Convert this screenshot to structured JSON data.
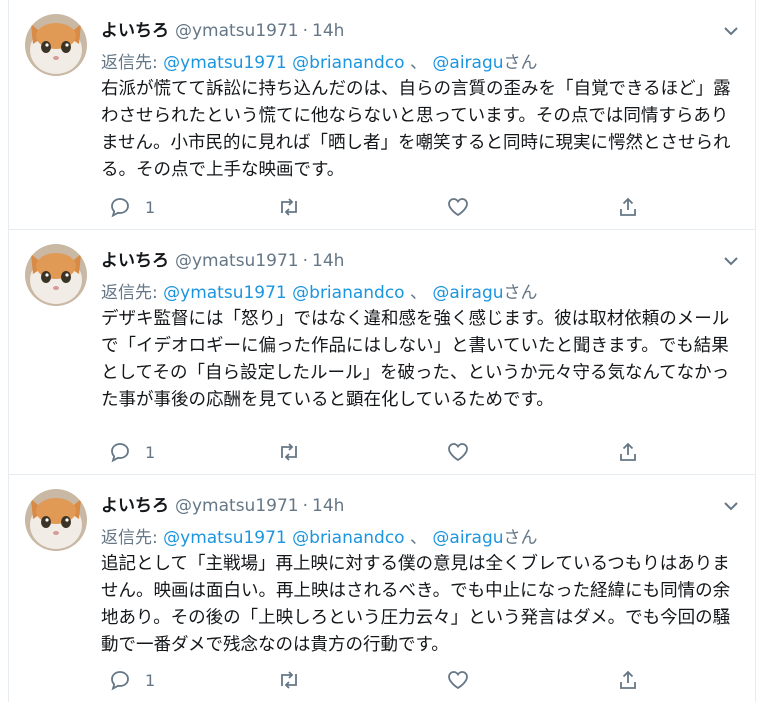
{
  "tweets": [
    {
      "name": "よいちろ",
      "handle": "@ymatsu1971",
      "dot": "·",
      "time": "14h",
      "reply_prefix": "返信先:",
      "reply_to_1": "@ymatsu1971",
      "reply_to_2": "@brianandco",
      "reply_sep": "、",
      "reply_to_3": "@airagu",
      "reply_suffix": "さん",
      "text": "右派が慌てて訴訟に持ち込んだのは、自らの言質の歪みを「自覚できるほど」露わさせられたという慌てに他ならないと思っています。その点では同情すらありません。小市民的に見れば「晒し者」を嘲笑すると同時に現実に愕然とさせられる。その点で上手な映画です。",
      "reply_count": "1"
    },
    {
      "name": "よいちろ",
      "handle": "@ymatsu1971",
      "dot": "·",
      "time": "14h",
      "reply_prefix": "返信先:",
      "reply_to_1": "@ymatsu1971",
      "reply_to_2": "@brianandco",
      "reply_sep": "、",
      "reply_to_3": "@airagu",
      "reply_suffix": "さん",
      "text": "デザキ監督には「怒り」ではなく違和感を強く感じます。彼は取材依頼のメールで「イデオロギーに偏った作品にはしない」と書いていたと聞きます。でも結果としてその「自ら設定したルール」を破った、というか元々守る気なんてなかった事が事後の応酬を見ていると顕在化しているためです。",
      "reply_count": "1"
    },
    {
      "name": "よいちろ",
      "handle": "@ymatsu1971",
      "dot": "·",
      "time": "14h",
      "reply_prefix": "返信先:",
      "reply_to_1": "@ymatsu1971",
      "reply_to_2": "@brianandco",
      "reply_sep": "、",
      "reply_to_3": "@airagu",
      "reply_suffix": "さん",
      "text": "追記として「主戦場」再上映に対する僕の意見は全くブレているつもりはありません。映画は面白い。再上映はされるべき。でも中止になった経緯にも同情の余地あり。その後の「上映しろという圧力云々」という発言はダメ。でも今回の騒動で一番ダメで残念なのは貴方の行動です。",
      "reply_count": "1"
    }
  ],
  "colors": {
    "link": "#1b95e0",
    "muted": "#657786",
    "text": "#14171a",
    "divider": "#e6ecf0"
  },
  "icons": {
    "reply": "reply-icon",
    "retweet": "retweet-icon",
    "like": "heart-icon",
    "share": "share-icon",
    "caret": "chevron-down-icon",
    "avatar": "kitten-avatar"
  }
}
